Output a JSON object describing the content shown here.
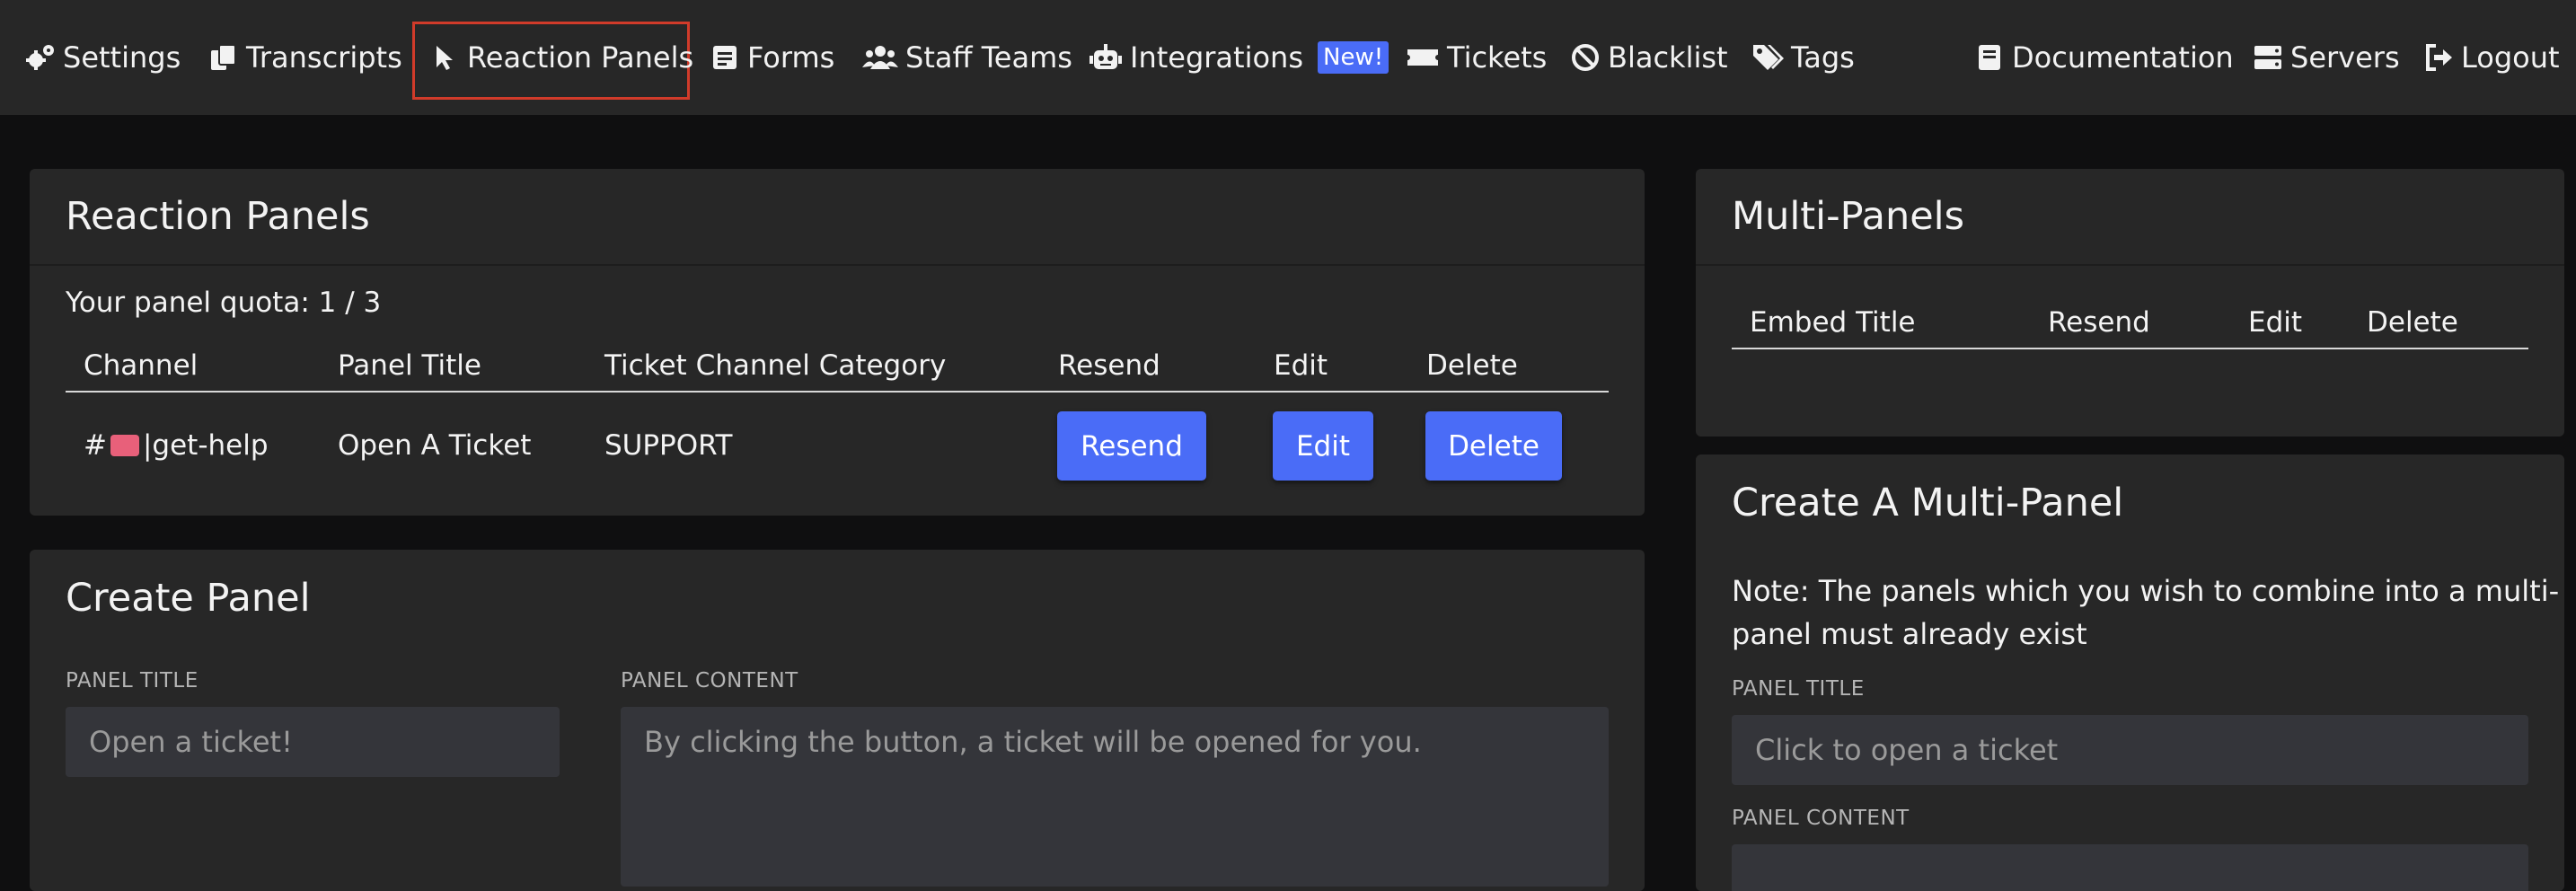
{
  "nav": {
    "settings": "Settings",
    "transcripts": "Transcripts",
    "reaction_panels": "Reaction Panels",
    "forms": "Forms",
    "staff_teams": "Staff Teams",
    "integrations": "Integrations",
    "integrations_badge": "New!",
    "tickets": "Tickets",
    "blacklist": "Blacklist",
    "tags": "Tags",
    "documentation": "Documentation",
    "servers": "Servers",
    "logout": "Logout",
    "active_item": "Reaction Panels"
  },
  "reaction_panels": {
    "title": "Reaction Panels",
    "quota": "Your panel quota: 1 / 3",
    "columns": [
      "Channel",
      "Panel Title",
      "Ticket Channel Category",
      "Resend",
      "Edit",
      "Delete"
    ],
    "rows": [
      {
        "channel_prefix": "#",
        "channel_emoji": "ticket-emoji",
        "channel_suffix": "|get-help",
        "panel_title": "Open A Ticket",
        "category": "SUPPORT",
        "resend_label": "Resend",
        "edit_label": "Edit",
        "delete_label": "Delete"
      }
    ]
  },
  "create_panel": {
    "title": "Create Panel",
    "panel_title_label": "PANEL TITLE",
    "panel_title_placeholder": "Open a ticket!",
    "panel_content_label": "PANEL CONTENT",
    "panel_content_placeholder": "By clicking the button, a ticket will be opened for you."
  },
  "multi_panels": {
    "title": "Multi-Panels",
    "columns": [
      "Embed Title",
      "Resend",
      "Edit",
      "Delete"
    ]
  },
  "create_multi_panel": {
    "title": "Create A Multi-Panel",
    "note_line1": "Note: The panels which you wish to combine into a multi-",
    "note_line2": "panel must already exist",
    "panel_title_label": "PANEL TITLE",
    "panel_title_placeholder": "Click to open a ticket",
    "panel_content_label": "PANEL CONTENT"
  },
  "colors": {
    "background": "#0f0f10",
    "navbar": "#272727",
    "card": "#272727",
    "accent_button": "#4a6cf7",
    "active_outline": "#d13b2a",
    "input": "#34353a"
  }
}
